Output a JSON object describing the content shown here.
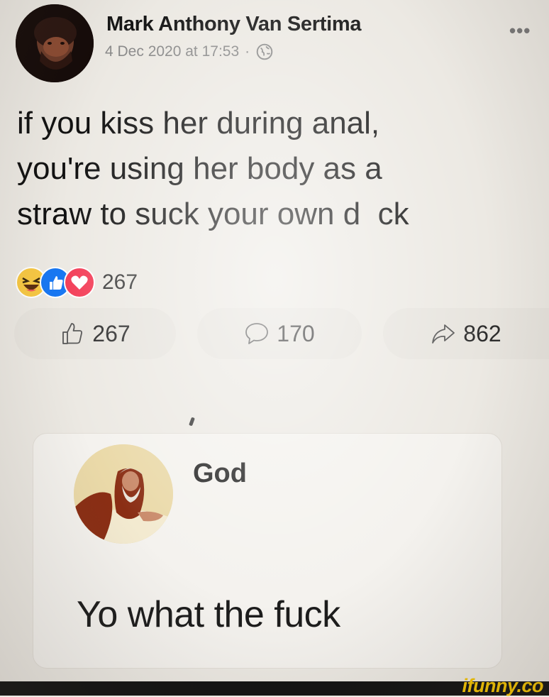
{
  "post": {
    "author": "Mark Anthony Van Sertima",
    "timestamp": "4 Dec 2020 at 17:53",
    "separator": "·",
    "privacy_icon": "globe-icon",
    "more_label": "•••",
    "text_lines": [
      "if you kiss her during anal,",
      "you're using her body as a",
      "straw to suck your own d  ck"
    ],
    "reactions": {
      "icons": [
        "haha-icon",
        "like-icon",
        "love-icon"
      ],
      "count": "267"
    },
    "actions": [
      {
        "icon": "thumbs-up-icon",
        "count": "267"
      },
      {
        "icon": "comment-icon",
        "count": "170"
      },
      {
        "icon": "share-icon",
        "count": "862"
      }
    ]
  },
  "comment": {
    "author": "God",
    "text": "Yo what the fuck"
  },
  "watermark": "ifunny.co",
  "colors": {
    "background": "#ece9e3",
    "meta_text": "#8a8a8a",
    "like_blue": "#1877f2",
    "love_red": "#f33e58",
    "haha_yellow": "#f7c843",
    "watermark": "#f5c400"
  }
}
